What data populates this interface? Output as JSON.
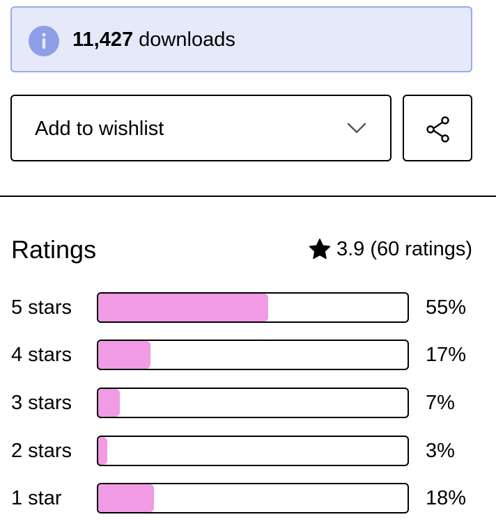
{
  "banner": {
    "count": "11,427",
    "suffix": " downloads",
    "icon": "info-icon",
    "color": "#e5e9fa"
  },
  "wishlist": {
    "label": "Add to wishlist",
    "icon": "chevron-down-icon"
  },
  "share": {
    "icon": "share-icon"
  },
  "ratings": {
    "title": "Ratings",
    "average": "3.9",
    "count_text": "(60 ratings)",
    "bar_color": "#f09be3",
    "rows": [
      {
        "label": "5 stars",
        "percent_text": "55%",
        "fill": 0.55
      },
      {
        "label": "4 stars",
        "percent_text": "17%",
        "fill": 0.17
      },
      {
        "label": "3 stars",
        "percent_text": "7%",
        "fill": 0.07
      },
      {
        "label": "2 stars",
        "percent_text": "3%",
        "fill": 0.03
      },
      {
        "label": "1 star",
        "percent_text": "18%",
        "fill": 0.18
      }
    ]
  }
}
